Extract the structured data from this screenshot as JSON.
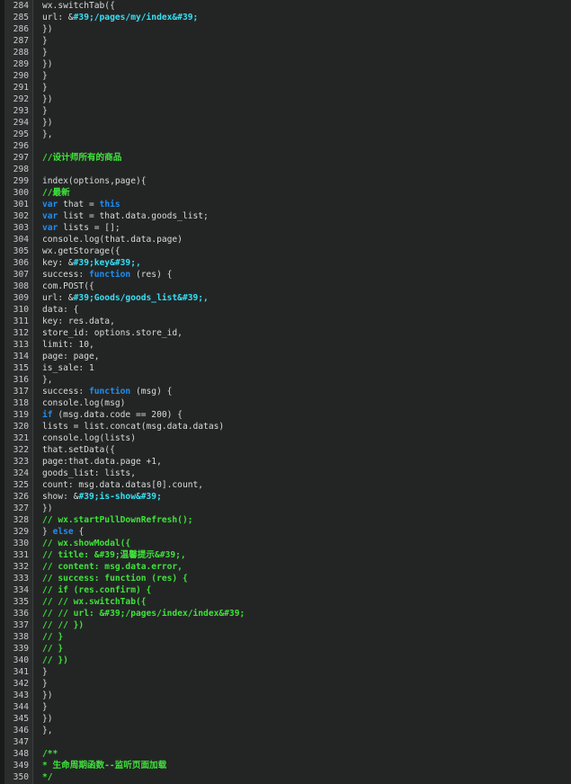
{
  "editor": {
    "colors": {
      "background": "#232525",
      "gutter": "#2b2d2d",
      "plain": "#d9dcdc",
      "string": "#37e0f5",
      "keyword": "#1f8ef2",
      "comment": "#3fe33a",
      "line_number": "#c8cccc"
    },
    "lines": [
      {
        "n": "284",
        "s": [
          {
            "t": "wx.switchTab({",
            "c": "plain"
          }
        ]
      },
      {
        "n": "285",
        "s": [
          {
            "t": "url: &",
            "c": "plain"
          },
          {
            "t": "#39;/pages/my/index&#39;",
            "c": "str"
          }
        ]
      },
      {
        "n": "286",
        "s": [
          {
            "t": "})",
            "c": "plain"
          }
        ]
      },
      {
        "n": "287",
        "s": [
          {
            "t": "}",
            "c": "plain"
          }
        ]
      },
      {
        "n": "288",
        "s": [
          {
            "t": "}",
            "c": "plain"
          }
        ]
      },
      {
        "n": "289",
        "s": [
          {
            "t": "})",
            "c": "plain"
          }
        ]
      },
      {
        "n": "290",
        "s": [
          {
            "t": "}",
            "c": "plain"
          }
        ]
      },
      {
        "n": "291",
        "s": [
          {
            "t": "}",
            "c": "plain"
          }
        ]
      },
      {
        "n": "292",
        "s": [
          {
            "t": "})",
            "c": "plain"
          }
        ]
      },
      {
        "n": "293",
        "s": [
          {
            "t": "}",
            "c": "plain"
          }
        ]
      },
      {
        "n": "294",
        "s": [
          {
            "t": "})",
            "c": "plain"
          }
        ]
      },
      {
        "n": "295",
        "s": [
          {
            "t": "},",
            "c": "plain"
          }
        ]
      },
      {
        "n": "296",
        "s": []
      },
      {
        "n": "297",
        "s": [
          {
            "t": "//设计师所有的商品",
            "c": "com"
          }
        ]
      },
      {
        "n": "298",
        "s": []
      },
      {
        "n": "299",
        "s": [
          {
            "t": "index(options,page){",
            "c": "plain"
          }
        ]
      },
      {
        "n": "300",
        "s": [
          {
            "t": "//最新",
            "c": "com"
          }
        ]
      },
      {
        "n": "301",
        "s": [
          {
            "t": "var",
            "c": "kw"
          },
          {
            "t": " that = ",
            "c": "plain"
          },
          {
            "t": "this",
            "c": "kw"
          }
        ]
      },
      {
        "n": "302",
        "s": [
          {
            "t": "var",
            "c": "kw"
          },
          {
            "t": " list = that.data.goods_list;",
            "c": "plain"
          }
        ]
      },
      {
        "n": "303",
        "s": [
          {
            "t": "var",
            "c": "kw"
          },
          {
            "t": " lists = [];",
            "c": "plain"
          }
        ]
      },
      {
        "n": "304",
        "s": [
          {
            "t": "console.log(that.data.page)",
            "c": "plain"
          }
        ]
      },
      {
        "n": "305",
        "s": [
          {
            "t": "wx.getStorage({",
            "c": "plain"
          }
        ]
      },
      {
        "n": "306",
        "s": [
          {
            "t": "key: &",
            "c": "plain"
          },
          {
            "t": "#39;key&#39;,",
            "c": "str"
          }
        ]
      },
      {
        "n": "307",
        "s": [
          {
            "t": "success: ",
            "c": "plain"
          },
          {
            "t": "function",
            "c": "kw"
          },
          {
            "t": " (res) {",
            "c": "plain"
          }
        ]
      },
      {
        "n": "308",
        "s": [
          {
            "t": "com.POST({",
            "c": "plain"
          }
        ]
      },
      {
        "n": "309",
        "s": [
          {
            "t": "url: &",
            "c": "plain"
          },
          {
            "t": "#39;Goods/goods_list&#39;,",
            "c": "str"
          }
        ]
      },
      {
        "n": "310",
        "s": [
          {
            "t": "data: {",
            "c": "plain"
          }
        ]
      },
      {
        "n": "311",
        "s": [
          {
            "t": "key: res.data,",
            "c": "plain"
          }
        ]
      },
      {
        "n": "312",
        "s": [
          {
            "t": "store_id: options.store_id,",
            "c": "plain"
          }
        ]
      },
      {
        "n": "313",
        "s": [
          {
            "t": "limit: 10,",
            "c": "plain"
          }
        ]
      },
      {
        "n": "314",
        "s": [
          {
            "t": "page: page,",
            "c": "plain"
          }
        ]
      },
      {
        "n": "315",
        "s": [
          {
            "t": "is_sale: 1",
            "c": "plain"
          }
        ]
      },
      {
        "n": "316",
        "s": [
          {
            "t": "},",
            "c": "plain"
          }
        ]
      },
      {
        "n": "317",
        "s": [
          {
            "t": "success: ",
            "c": "plain"
          },
          {
            "t": "function",
            "c": "kw"
          },
          {
            "t": " (msg) {",
            "c": "plain"
          }
        ]
      },
      {
        "n": "318",
        "s": [
          {
            "t": "console.log(msg)",
            "c": "plain"
          }
        ]
      },
      {
        "n": "319",
        "s": [
          {
            "t": "if",
            "c": "kw"
          },
          {
            "t": " (msg.data.code == 200) {",
            "c": "plain"
          }
        ]
      },
      {
        "n": "320",
        "s": [
          {
            "t": "lists = list.concat(msg.data.datas)",
            "c": "plain"
          }
        ]
      },
      {
        "n": "321",
        "s": [
          {
            "t": "console.log(lists)",
            "c": "plain"
          }
        ]
      },
      {
        "n": "322",
        "s": [
          {
            "t": "that.setData({",
            "c": "plain"
          }
        ]
      },
      {
        "n": "323",
        "s": [
          {
            "t": "page:that.data.page +1,",
            "c": "plain"
          }
        ]
      },
      {
        "n": "324",
        "s": [
          {
            "t": "goods_list: lists,",
            "c": "plain"
          }
        ]
      },
      {
        "n": "325",
        "s": [
          {
            "t": "count: msg.data.datas[0].count,",
            "c": "plain"
          }
        ]
      },
      {
        "n": "326",
        "s": [
          {
            "t": "show: &",
            "c": "plain"
          },
          {
            "t": "#39;is-show&#39;",
            "c": "str"
          }
        ]
      },
      {
        "n": "327",
        "s": [
          {
            "t": "})",
            "c": "plain"
          }
        ]
      },
      {
        "n": "328",
        "s": [
          {
            "t": "// wx.startPullDownRefresh();",
            "c": "com"
          }
        ]
      },
      {
        "n": "329",
        "s": [
          {
            "t": "} ",
            "c": "plain"
          },
          {
            "t": "else",
            "c": "kw"
          },
          {
            "t": " {",
            "c": "plain"
          }
        ]
      },
      {
        "n": "330",
        "s": [
          {
            "t": "// wx.showModal({",
            "c": "com"
          }
        ]
      },
      {
        "n": "331",
        "s": [
          {
            "t": "// title: &#39;温馨提示&#39;,",
            "c": "com"
          }
        ]
      },
      {
        "n": "332",
        "s": [
          {
            "t": "// content: msg.data.error,",
            "c": "com"
          }
        ]
      },
      {
        "n": "333",
        "s": [
          {
            "t": "// success: function (res) {",
            "c": "com"
          }
        ]
      },
      {
        "n": "334",
        "s": [
          {
            "t": "// if (res.confirm) {",
            "c": "com"
          }
        ]
      },
      {
        "n": "335",
        "s": [
          {
            "t": "// // wx.switchTab({",
            "c": "com"
          }
        ]
      },
      {
        "n": "336",
        "s": [
          {
            "t": "// // url: &#39;/pages/index/index&#39;",
            "c": "com"
          }
        ]
      },
      {
        "n": "337",
        "s": [
          {
            "t": "// // })",
            "c": "com"
          }
        ]
      },
      {
        "n": "338",
        "s": [
          {
            "t": "// }",
            "c": "com"
          }
        ]
      },
      {
        "n": "339",
        "s": [
          {
            "t": "// }",
            "c": "com"
          }
        ]
      },
      {
        "n": "340",
        "s": [
          {
            "t": "// })",
            "c": "com"
          }
        ]
      },
      {
        "n": "341",
        "s": [
          {
            "t": "}",
            "c": "plain"
          }
        ]
      },
      {
        "n": "342",
        "s": [
          {
            "t": "}",
            "c": "plain"
          }
        ]
      },
      {
        "n": "343",
        "s": [
          {
            "t": "})",
            "c": "plain"
          }
        ]
      },
      {
        "n": "344",
        "s": [
          {
            "t": "}",
            "c": "plain"
          }
        ]
      },
      {
        "n": "345",
        "s": [
          {
            "t": "})",
            "c": "plain"
          }
        ]
      },
      {
        "n": "346",
        "s": [
          {
            "t": "},",
            "c": "plain"
          }
        ]
      },
      {
        "n": "347",
        "s": []
      },
      {
        "n": "348",
        "s": [
          {
            "t": "/**",
            "c": "com"
          }
        ]
      },
      {
        "n": "349",
        "s": [
          {
            "t": "* 生命周期函数--监听页面加载",
            "c": "com"
          }
        ]
      },
      {
        "n": "350",
        "s": [
          {
            "t": "*/",
            "c": "com"
          }
        ]
      }
    ]
  }
}
